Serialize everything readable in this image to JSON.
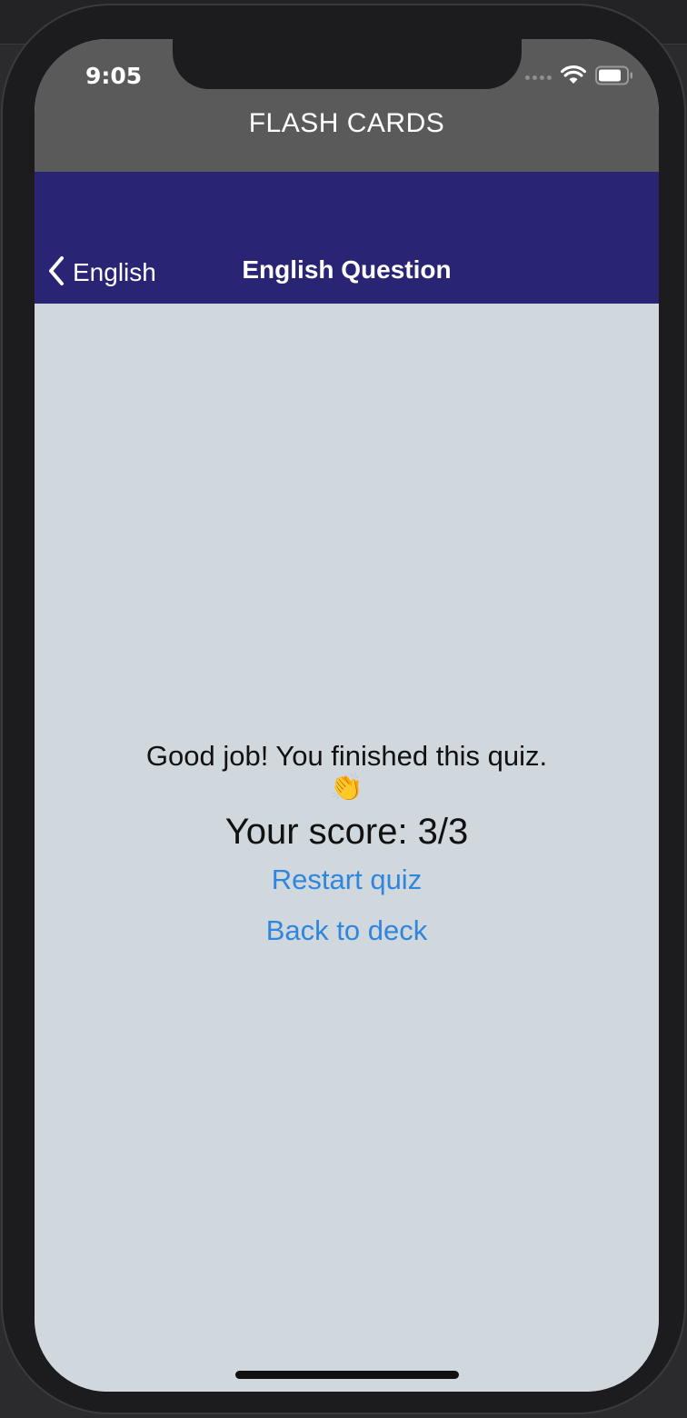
{
  "status_bar": {
    "time": "9:05"
  },
  "app": {
    "title": "FLASH CARDS"
  },
  "nav": {
    "back_label": "English",
    "title": "English Question"
  },
  "result": {
    "message": "Good job! You finished this quiz.",
    "emoji": "👏",
    "score": "Your score: 3/3",
    "restart_label": "Restart quiz",
    "back_to_deck_label": "Back to deck"
  },
  "colors": {
    "header_bg": "#5a5a5a",
    "nav_bg": "#2a2474",
    "content_bg": "#d0d8de",
    "link": "#2f86dd"
  },
  "icons": {
    "back": "chevron-left-icon",
    "wifi": "wifi-icon",
    "battery": "battery-icon",
    "signal": "signal-dots-icon"
  }
}
